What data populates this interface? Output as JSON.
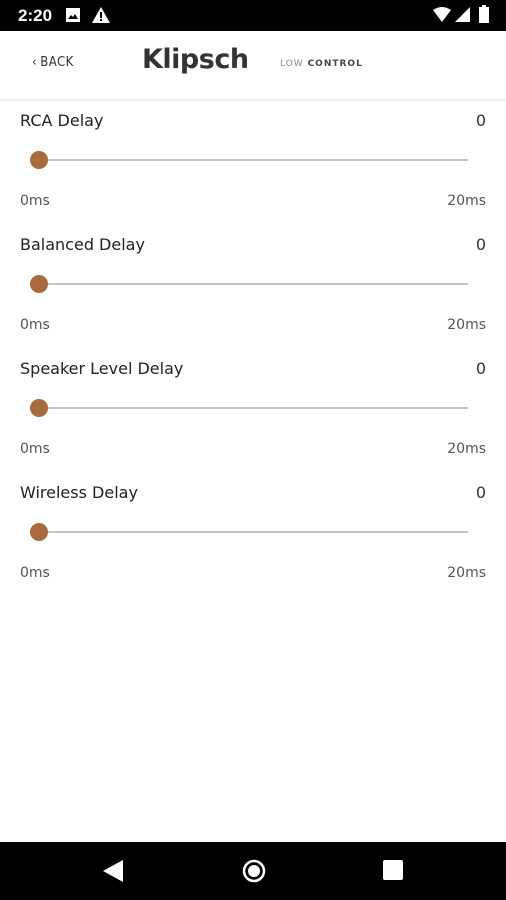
{
  "status_bar": {
    "time": "2:20",
    "icons": [
      "image-icon",
      "alert-icon",
      "wifi-icon",
      "signal-icon",
      "battery-icon"
    ]
  },
  "header": {
    "back_label": "BACK",
    "brand": "Klipsch",
    "subtitle_light": "LOW",
    "subtitle_strong": "CONTROL"
  },
  "delays": [
    {
      "label": "RCA Delay",
      "value": "0",
      "min_label": "0ms",
      "max_label": "20ms",
      "fraction": 0
    },
    {
      "label": "Balanced Delay",
      "value": "0",
      "min_label": "0ms",
      "max_label": "20ms",
      "fraction": 0
    },
    {
      "label": "Speaker Level Delay",
      "value": "0",
      "min_label": "0ms",
      "max_label": "20ms",
      "fraction": 0
    },
    {
      "label": "Wireless Delay",
      "value": "0",
      "min_label": "0ms",
      "max_label": "20ms",
      "fraction": 0
    }
  ],
  "colors": {
    "accent": "#a76a3c",
    "track": "#c4c4c4"
  },
  "nav": {
    "icons": [
      "back-triangle-icon",
      "home-circle-icon",
      "recents-square-icon"
    ]
  }
}
